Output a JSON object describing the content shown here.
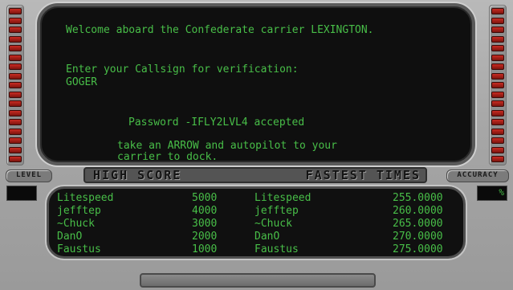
{
  "screen": {
    "lines": [
      "Welcome aboard the Confederate carrier LEXINGTON.",
      "Enter your Callsign for verification:",
      "GOGER",
      "Password -IFLY2LVL4 accepted",
      "take an ARROW and autopilot to your",
      "carrier to dock."
    ]
  },
  "panels": {
    "level_label": "LEVEL",
    "accuracy_label": "ACCURACY",
    "accuracy_unit": "%",
    "high_score_label": "HIGH SCORE",
    "fastest_times_label": "FASTEST TIMES"
  },
  "high_scores": [
    {
      "name": "Litespeed",
      "score": "5000"
    },
    {
      "name": "jefftep",
      "score": "4000"
    },
    {
      "name": "~Chuck",
      "score": "3000"
    },
    {
      "name": "DanO",
      "score": "2000"
    },
    {
      "name": "Faustus",
      "score": "1000"
    }
  ],
  "fastest_times": [
    {
      "name": "Litespeed",
      "time": "255.0000"
    },
    {
      "name": "jefftep",
      "time": "260.0000"
    },
    {
      "name": "~Chuck",
      "time": "265.0000"
    },
    {
      "name": "DanO",
      "time": "270.0000"
    },
    {
      "name": "Faustus",
      "time": "275.0000"
    }
  ],
  "colors": {
    "terminal_green": "#48be48",
    "indicator_red": "#c82b22"
  }
}
